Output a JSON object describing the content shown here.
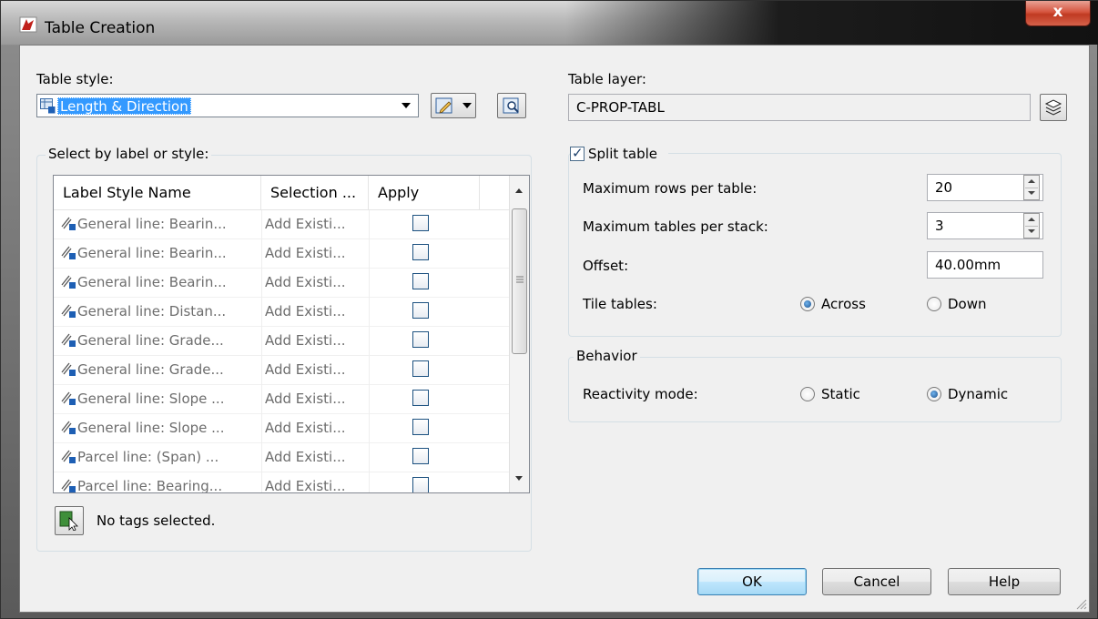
{
  "window": {
    "title": "Table Creation",
    "close_glyph": "x"
  },
  "table_style": {
    "label": "Table style:",
    "value": "Length & Direction"
  },
  "select_group": {
    "title": "Select by label or style:",
    "columns": [
      "Label Style Name",
      "Selection ...",
      "Apply"
    ],
    "rows": [
      {
        "name": "General line: Bearin...",
        "selection": "Add Existi..."
      },
      {
        "name": "General line: Bearin...",
        "selection": "Add Existi..."
      },
      {
        "name": "General line: Bearin...",
        "selection": "Add Existi..."
      },
      {
        "name": "General line: Distan...",
        "selection": "Add Existi..."
      },
      {
        "name": "General line: Grade...",
        "selection": "Add Existi..."
      },
      {
        "name": "General line: Grade...",
        "selection": "Add Existi..."
      },
      {
        "name": "General line: Slope ...",
        "selection": "Add Existi..."
      },
      {
        "name": "General line: Slope ...",
        "selection": "Add Existi..."
      },
      {
        "name": "Parcel line: (Span) ...",
        "selection": "Add Existi..."
      },
      {
        "name": "Parcel line: Bearing...",
        "selection": "Add Existi..."
      }
    ],
    "status": "No tags selected."
  },
  "table_layer": {
    "label": "Table layer:",
    "value": "C-PROP-TABL"
  },
  "split_table": {
    "label": "Split table",
    "checked": true,
    "max_rows_label": "Maximum rows per table:",
    "max_rows_value": "20",
    "max_tables_label": "Maximum tables per stack:",
    "max_tables_value": "3",
    "offset_label": "Offset:",
    "offset_value": "40.00mm",
    "tile_label": "Tile tables:",
    "tile_across": "Across",
    "tile_down": "Down",
    "tile_selected": "Across"
  },
  "behavior": {
    "title": "Behavior",
    "reactivity_label": "Reactivity mode:",
    "static_label": "Static",
    "dynamic_label": "Dynamic",
    "selected": "Dynamic"
  },
  "buttons": {
    "ok": "OK",
    "cancel": "Cancel",
    "help": "Help"
  },
  "colors": {
    "selection_highlight": "#3399ff",
    "close_red": "#c03a22",
    "default_button": "#3c7fb1"
  }
}
